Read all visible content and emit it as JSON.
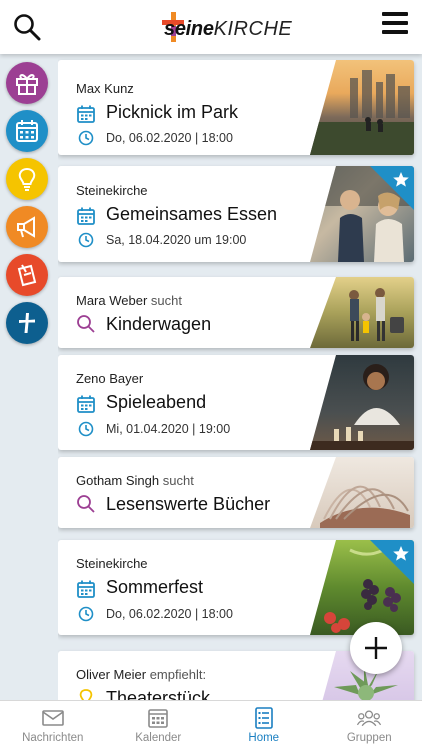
{
  "header": {
    "logo_bold": "seine",
    "logo_regular": "KIRCHE",
    "search_icon": "search-icon",
    "menu_icon": "hamburger-menu-icon"
  },
  "categories": [
    {
      "icon": "gift-icon",
      "color": "#9c3f93"
    },
    {
      "icon": "calendar-icon",
      "color": "#1f8fc7"
    },
    {
      "icon": "lightbulb-icon",
      "color": "#f5c400"
    },
    {
      "icon": "megaphone-icon",
      "color": "#f08a24"
    },
    {
      "icon": "note-icon",
      "color": "#e74a2a"
    },
    {
      "icon": "cross-icon",
      "color": "#0d5f8f"
    }
  ],
  "cards": [
    {
      "author": "Max Kunz",
      "suffix": "",
      "title": "Picknick im Park",
      "kind": "event",
      "date": "Do, 06.02.2020 | 18:00",
      "starred": false
    },
    {
      "author": "Steinekirche",
      "suffix": "",
      "title": "Gemeinsames Essen",
      "kind": "event",
      "date": "Sa, 18.04.2020 um 19:00",
      "starred": true
    },
    {
      "author": "Mara Weber",
      "suffix": "sucht",
      "title": "Kinderwagen",
      "kind": "search",
      "date": "",
      "starred": false
    },
    {
      "author": "Zeno Bayer",
      "suffix": "",
      "title": "Spieleabend",
      "kind": "event",
      "date": "Mi, 01.04.2020 | 19:00",
      "starred": false
    },
    {
      "author": "Gotham Singh",
      "suffix": "sucht",
      "title": "Lesenswerte Bücher",
      "kind": "search",
      "date": "",
      "starred": false
    },
    {
      "author": "Steinekirche",
      "suffix": "",
      "title": "Sommerfest",
      "kind": "event",
      "date": "Do, 06.02.2020 | 18:00",
      "starred": true
    },
    {
      "author": "Oliver Meier",
      "suffix": "empfiehlt:",
      "title": "Theaterstück",
      "kind": "tip",
      "date": "",
      "starred": false
    }
  ],
  "fab": {
    "icon": "plus-icon"
  },
  "tabs": [
    {
      "label": "Nachrichten",
      "icon": "mail-icon",
      "active": false
    },
    {
      "label": "Kalender",
      "icon": "calendar-icon",
      "active": false
    },
    {
      "label": "Home",
      "icon": "home-list-icon",
      "active": true
    },
    {
      "label": "Gruppen",
      "icon": "group-icon",
      "active": false
    }
  ],
  "colors": {
    "accent": "#1a7fc1",
    "event_icon": "#1f8fc7",
    "search_icon": "#9c3f93",
    "star_badge": "#1f8fc7"
  }
}
